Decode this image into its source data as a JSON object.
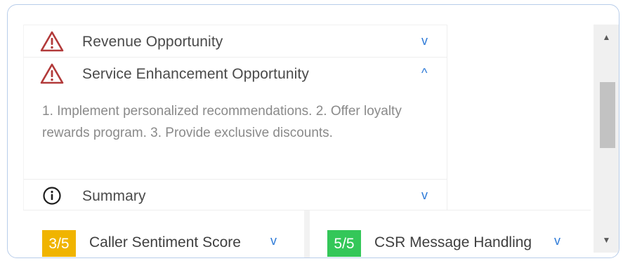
{
  "accordion": {
    "items": [
      {
        "title": "Revenue Opportunity",
        "chevron": "v",
        "icon": "warning-triangle-icon",
        "expanded": false
      },
      {
        "title": "Service Enhancement Opportunity",
        "chevron": "^",
        "icon": "warning-triangle-icon",
        "expanded": true,
        "detail": "1. Implement personalized recommendations. 2. Offer loyalty rewards program. 3. Provide exclusive discounts."
      },
      {
        "title": "Summary",
        "chevron": "v",
        "icon": "info-circle-icon",
        "expanded": false
      }
    ]
  },
  "scores": [
    {
      "badge": "3/5",
      "label": "Caller Sentiment Score",
      "chevron": "v",
      "color": "#f0b400",
      "score": 3,
      "max": 5
    },
    {
      "badge": "5/5",
      "label": "CSR Message Handling",
      "chevron": "v",
      "color": "#34c759",
      "score": 5,
      "max": 5
    }
  ],
  "colors": {
    "accent": "#2f7bd8",
    "warning_icon": "#b23a3a",
    "panel_border": "#b8cdea"
  }
}
